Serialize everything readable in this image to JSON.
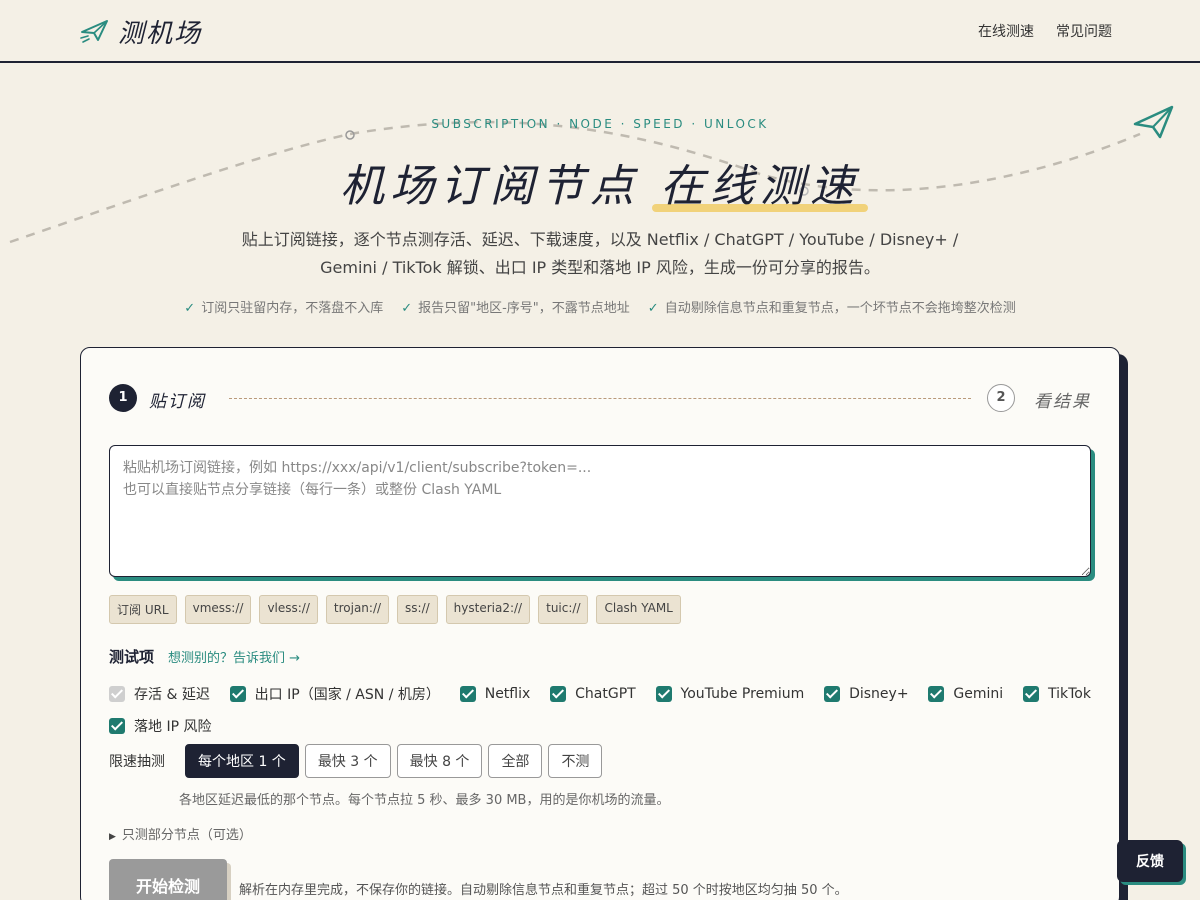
{
  "header": {
    "logo_text": "测机场",
    "nav": [
      "在线测速",
      "常见问题"
    ]
  },
  "hero": {
    "kicker": "SUBSCRIPTION · NODE · SPEED · UNLOCK",
    "title_main": "机场订阅节点 ",
    "title_highlight": "在线测速",
    "subtitle_line1": "贴上订阅链接，逐个节点测存活、延迟、下载速度，以及 Netflix / ChatGPT / YouTube / Disney+ /",
    "subtitle_line2": "Gemini / TikTok 解锁、出口 IP 类型和落地 IP 风险，生成一份可分享的报告。",
    "checks": [
      "订阅只驻留内存，不落盘不入库",
      "报告只留\"地区-序号\"，不露节点地址",
      "自动剔除信息节点和重复节点，一个坏节点不会拖垮整次检测"
    ],
    "check_mark": "✓"
  },
  "steps": {
    "step1_num": "1",
    "step1_label": "贴订阅",
    "step2_num": "2",
    "step2_label": "看结果"
  },
  "input": {
    "placeholder": "粘贴机场订阅链接，例如 https://xxx/api/v1/client/subscribe?token=...\n也可以直接贴节点分享链接（每行一条）或整份 Clash YAML",
    "value": ""
  },
  "formats": [
    "订阅 URL",
    "vmess://",
    "vless://",
    "trojan://",
    "ss://",
    "hysteria2://",
    "tuic://",
    "Clash YAML"
  ],
  "tests": {
    "title": "测试项",
    "link": "想测别的？告诉我们 →",
    "options": [
      {
        "label": "存活 & 延迟",
        "checked": true,
        "disabled": true
      },
      {
        "label": "出口 IP（国家 / ASN / 机房）",
        "checked": true,
        "disabled": false
      },
      {
        "label": "Netflix",
        "checked": true,
        "disabled": false
      },
      {
        "label": "ChatGPT",
        "checked": true,
        "disabled": false
      },
      {
        "label": "YouTube Premium",
        "checked": true,
        "disabled": false
      },
      {
        "label": "Disney+",
        "checked": true,
        "disabled": false
      },
      {
        "label": "Gemini",
        "checked": true,
        "disabled": false
      },
      {
        "label": "TikTok",
        "checked": true,
        "disabled": false
      },
      {
        "label": "落地 IP 风险",
        "checked": true,
        "disabled": false
      }
    ]
  },
  "speed": {
    "label": "限速抽测",
    "buttons": [
      "每个地区 1 个",
      "最快 3 个",
      "最快 8 个",
      "全部",
      "不测"
    ],
    "selected": "每个地区 1 个",
    "hint": "各地区延迟最低的那个节点。每个节点拉 5 秒、最多 30 MB，用的是你机场的流量。"
  },
  "subset": {
    "label": "只测部分节点（可选）"
  },
  "start": {
    "label": "开始检测",
    "hint": "解析在内存里完成，不保存你的链接。自动剔除信息节点和重复节点；超过 50 个时按地区均匀抽 50 个。"
  },
  "feedback": {
    "label": "反馈"
  },
  "colors": {
    "accent": "#2a8c80",
    "dark": "#1e2233",
    "background": "#f4f0e6",
    "highlight": "#f1d27a"
  }
}
